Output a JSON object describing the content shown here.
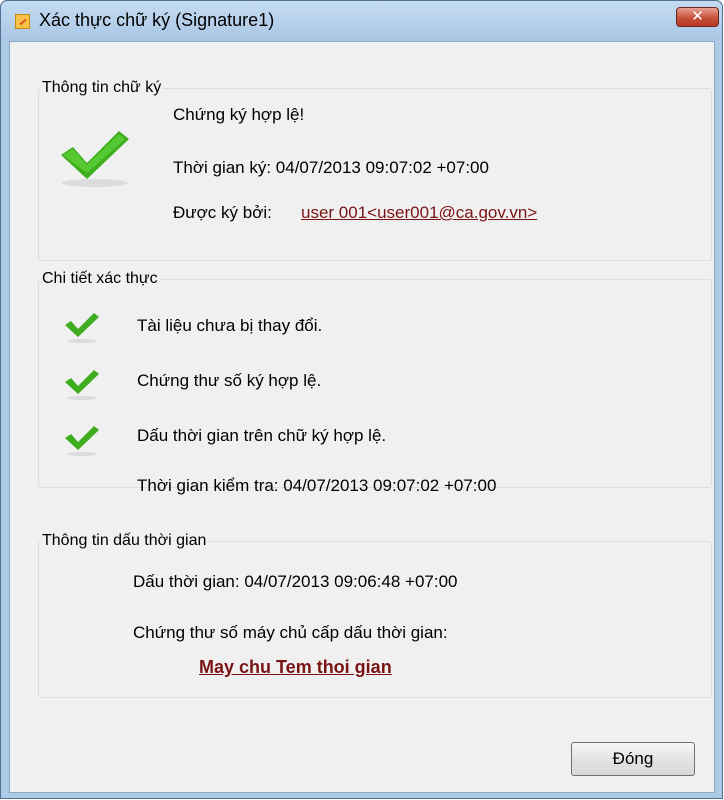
{
  "window": {
    "title": "Xác thực chữ ký (Signature1)",
    "close_glyph": "✕"
  },
  "signature_info": {
    "legend": "Thông tin chữ ký",
    "status": "Chứng ký hợp lệ!",
    "signed_time": "Thời gian ký: 04/07/2013 09:07:02 +07:00",
    "signed_by_label": "Được ký bởi:",
    "signer_link": "user 001<user001@ca.gov.vn>",
    "icon": "check-icon"
  },
  "verification_details": {
    "legend": "Chi tiết xác thực",
    "items": [
      {
        "text": "Tài liệu chưa bị thay đổi.",
        "icon": "check-icon"
      },
      {
        "text": "Chứng thư số ký hợp lệ.",
        "icon": "check-icon"
      },
      {
        "text": "Dấu thời gian trên chữ ký hợp lệ.",
        "icon": "check-icon"
      }
    ],
    "check_time": "Thời gian kiểm tra: 04/07/2013 09:07:02 +07:00"
  },
  "timestamp_info": {
    "legend": "Thông tin dấu thời gian",
    "timestamp": "Dấu thời gian: 04/07/2013 09:06:48 +07:00",
    "tsa_cert_label": "Chứng thư số máy chủ cấp dấu thời gian:",
    "tsa_link": "May chu Tem thoi gian"
  },
  "footer": {
    "close_label": "Đóng"
  },
  "colors": {
    "check_green": "#3fae1e",
    "link": "#7a1414"
  }
}
